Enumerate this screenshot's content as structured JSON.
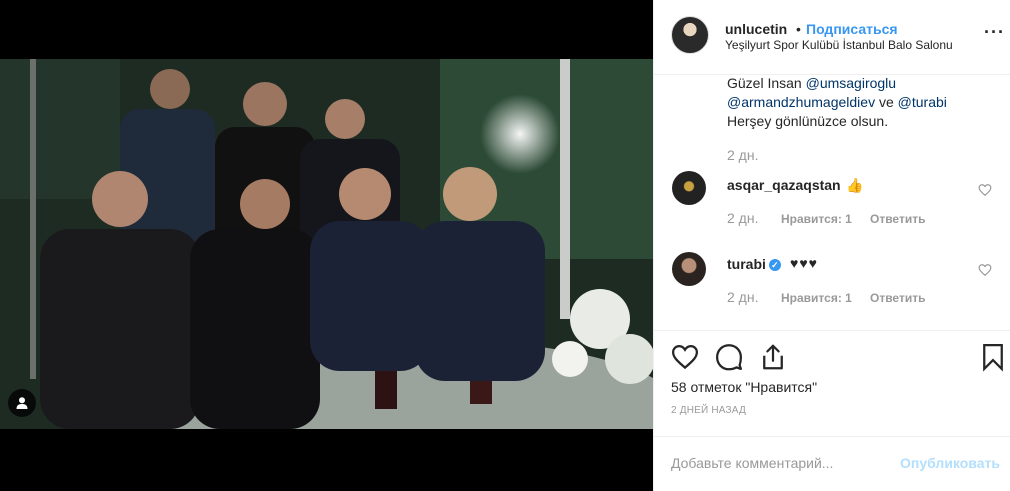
{
  "post": {
    "username": "unlucetin",
    "separator": "•",
    "follow_label": "Подписаться",
    "location": "Yeşilyurt Spor Kulübü İstanbul Balo Salonu",
    "more_icon": "more-icon"
  },
  "caption": {
    "prefix": "Güzel Insan ",
    "mention1": "@umsagiroglu",
    "mention2": "@armandzhumageldiev",
    "mid": " ve ",
    "mention3": "@turabi",
    "suffix": "Herşey gönlünüzce olsun.",
    "time": "2 дн."
  },
  "comments": [
    {
      "username": "asqar_qazaqstan",
      "text": "👍",
      "time": "2 дн.",
      "likes": "Нравится: 1",
      "reply": "Ответить"
    },
    {
      "username": "turabi",
      "verified": "✓",
      "text": "♥♥♥",
      "time": "2 дн.",
      "likes": "Нравится: 1",
      "reply": "Ответить"
    }
  ],
  "likes_count": "58 отметок \"Нравится\"",
  "post_date": "2 ДНЕЙ НАЗАД",
  "comment_input": {
    "placeholder": "Добавьте комментарий...",
    "publish_label": "Опубликовать"
  },
  "colors": {
    "accent": "#3897f0",
    "mention": "#003569",
    "muted": "#999999",
    "publish_disabled": "#b2dffc"
  }
}
